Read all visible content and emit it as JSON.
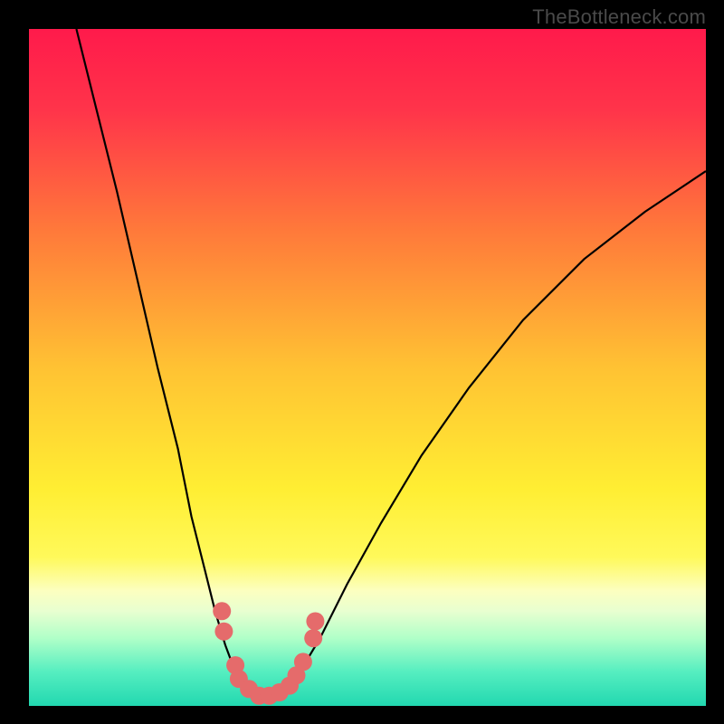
{
  "watermark": "TheBottleneck.com",
  "chart_data": {
    "type": "line",
    "title": "",
    "xlabel": "",
    "ylabel": "",
    "xlim": [
      0,
      100
    ],
    "ylim": [
      0,
      100
    ],
    "background_gradient": {
      "stops": [
        {
          "offset": 0.0,
          "color": "#ff1a4b"
        },
        {
          "offset": 0.12,
          "color": "#ff344a"
        },
        {
          "offset": 0.3,
          "color": "#ff7a3a"
        },
        {
          "offset": 0.5,
          "color": "#ffc233"
        },
        {
          "offset": 0.68,
          "color": "#ffee33"
        },
        {
          "offset": 0.78,
          "color": "#fff95a"
        },
        {
          "offset": 0.83,
          "color": "#fcffc0"
        },
        {
          "offset": 0.86,
          "color": "#e8ffd0"
        },
        {
          "offset": 0.9,
          "color": "#b0ffc8"
        },
        {
          "offset": 0.95,
          "color": "#55eec0"
        },
        {
          "offset": 1.0,
          "color": "#22d8b0"
        }
      ]
    },
    "series": [
      {
        "name": "left-curve",
        "type": "line",
        "color": "#000000",
        "points": [
          {
            "x": 7,
            "y": 100
          },
          {
            "x": 10,
            "y": 88
          },
          {
            "x": 13,
            "y": 76
          },
          {
            "x": 16,
            "y": 63
          },
          {
            "x": 19,
            "y": 50
          },
          {
            "x": 22,
            "y": 38
          },
          {
            "x": 24,
            "y": 28
          },
          {
            "x": 26,
            "y": 20
          },
          {
            "x": 27.5,
            "y": 14
          },
          {
            "x": 29,
            "y": 9
          },
          {
            "x": 30.5,
            "y": 5
          },
          {
            "x": 32,
            "y": 2.5
          },
          {
            "x": 34,
            "y": 1
          },
          {
            "x": 36,
            "y": 1
          },
          {
            "x": 38,
            "y": 2.5
          },
          {
            "x": 40,
            "y": 5
          },
          {
            "x": 43,
            "y": 10
          },
          {
            "x": 47,
            "y": 18
          },
          {
            "x": 52,
            "y": 27
          },
          {
            "x": 58,
            "y": 37
          },
          {
            "x": 65,
            "y": 47
          },
          {
            "x": 73,
            "y": 57
          },
          {
            "x": 82,
            "y": 66
          },
          {
            "x": 91,
            "y": 73
          },
          {
            "x": 100,
            "y": 79
          }
        ]
      },
      {
        "name": "bottom-markers",
        "type": "scatter",
        "color": "#e56b6b",
        "points": [
          {
            "x": 28.5,
            "y": 14
          },
          {
            "x": 28.8,
            "y": 11
          },
          {
            "x": 30.5,
            "y": 6
          },
          {
            "x": 31,
            "y": 4
          },
          {
            "x": 32.5,
            "y": 2.5
          },
          {
            "x": 34,
            "y": 1.5
          },
          {
            "x": 35.5,
            "y": 1.5
          },
          {
            "x": 37,
            "y": 2
          },
          {
            "x": 38.5,
            "y": 3
          },
          {
            "x": 39.5,
            "y": 4.5
          },
          {
            "x": 40.5,
            "y": 6.5
          },
          {
            "x": 42,
            "y": 10
          },
          {
            "x": 42.3,
            "y": 12.5
          }
        ]
      }
    ]
  }
}
